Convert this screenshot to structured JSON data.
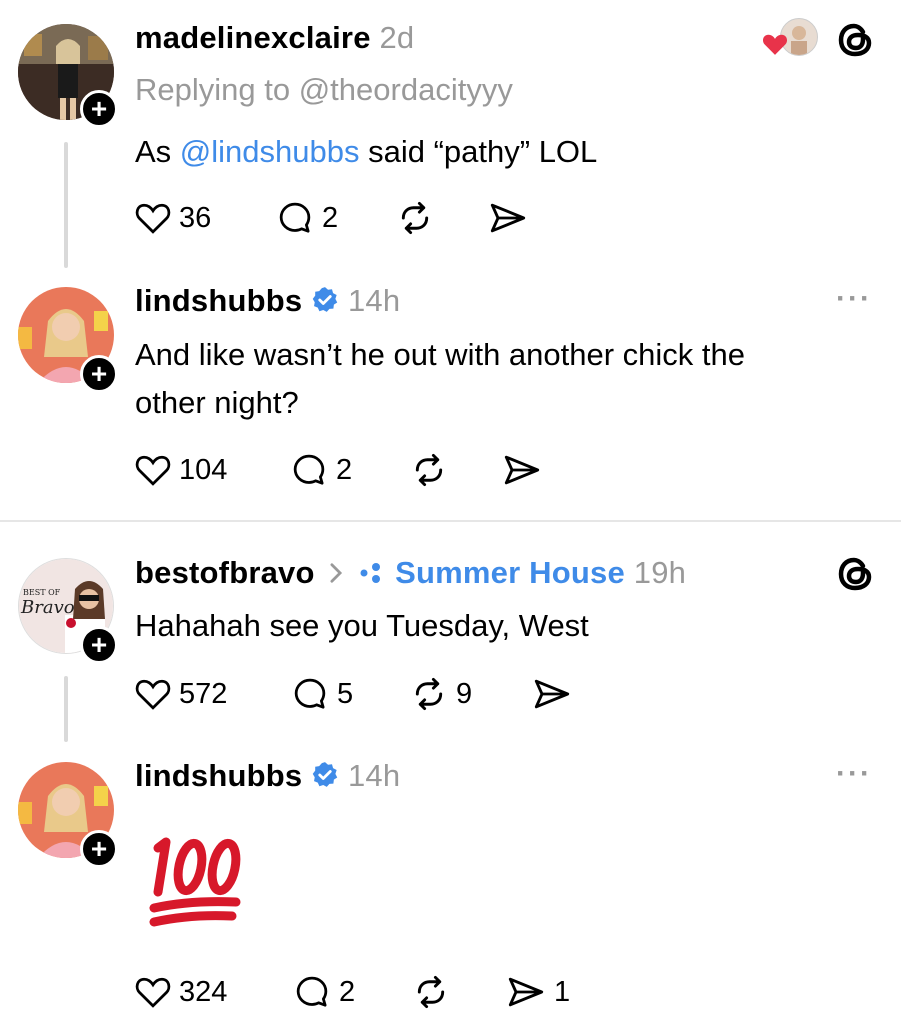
{
  "posts": [
    {
      "username": "madelinexclaire",
      "time": "2d",
      "replying": "Replying to @theordacityyy",
      "text_prefix": "As ",
      "mention": "@lindshubbs",
      "text_suffix": " said “pathy” LOL",
      "likes": "36",
      "replies": "2"
    },
    {
      "username": "lindshubbs",
      "time": "14h",
      "text_line1": "And like wasn’t he out with another chick the",
      "text_line2": "other night?",
      "likes": "104",
      "replies": "2"
    },
    {
      "username": "bestofbravo",
      "community": "Summer House",
      "time": "19h",
      "text": "Hahahah see you Tuesday, West",
      "likes": "572",
      "replies": "5",
      "reposts": "9",
      "avatar_text_top": "BEST OF",
      "avatar_text_bottom": "Bravo"
    },
    {
      "username": "lindshubbs",
      "time": "14h",
      "emoji": "💯",
      "likes": "324",
      "replies": "2",
      "shares": "1"
    }
  ],
  "colors": {
    "link": "#3f8be8",
    "verified": "#3f8be8",
    "heart": "#e8334a",
    "muted": "#999999"
  },
  "icons": [
    "heart-icon",
    "reply-icon",
    "repost-icon",
    "share-icon",
    "verified-icon",
    "threads-logo-icon",
    "more-icon",
    "follow-plus-icon",
    "chevron-right-icon",
    "community-icon"
  ]
}
